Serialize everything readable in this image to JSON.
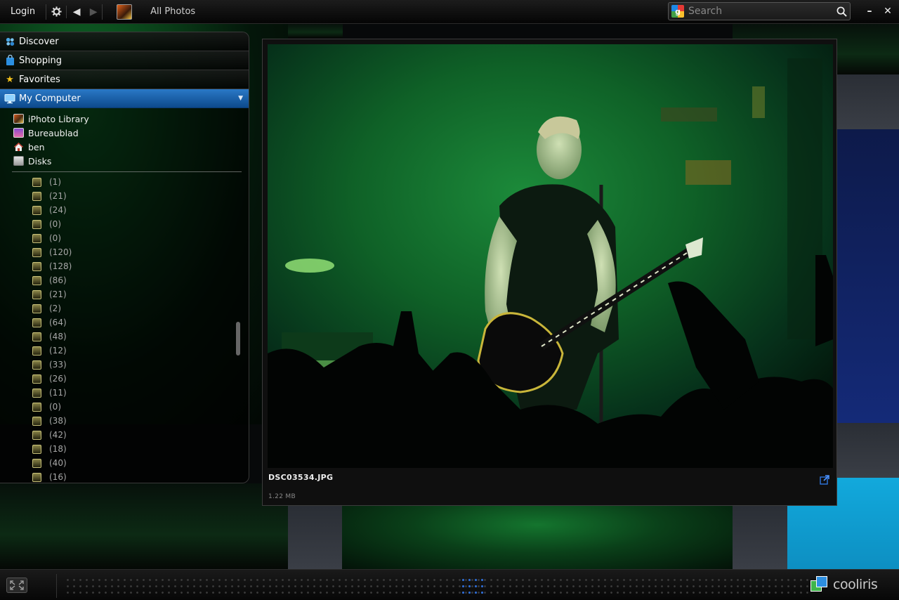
{
  "topbar": {
    "login": "Login",
    "settings_icon": "gear-icon",
    "back_icon": "back-arrow-icon",
    "forward_icon": "forward-arrow-icon",
    "album_icon": "iphoto-album-icon",
    "title": "All Photos",
    "search_placeholder": "Search",
    "search_provider_icon": "google-icon",
    "minimize_icon": "minimize-icon",
    "close_icon": "close-icon"
  },
  "sidebar": {
    "categories": [
      {
        "label": "Discover",
        "icon": "discover-icon"
      },
      {
        "label": "Shopping",
        "icon": "shopping-bag-icon"
      },
      {
        "label": "Favorites",
        "icon": "star-icon"
      },
      {
        "label": "My Computer",
        "icon": "monitor-icon",
        "active": true
      }
    ],
    "tree": [
      {
        "label": "iPhoto Library",
        "icon": "iphoto-icon"
      },
      {
        "label": "Bureaublad",
        "icon": "desktop-icon"
      },
      {
        "label": "ben",
        "icon": "home-icon"
      },
      {
        "label": "Disks",
        "icon": "disk-icon"
      }
    ],
    "albums": [
      "(1)",
      "(21)",
      "(24)",
      "(0)",
      "(0)",
      "(120)",
      "(128)",
      "(86)",
      "(21)",
      "(2)",
      "(64)",
      "(48)",
      "(12)",
      "(33)",
      "(26)",
      "(11)",
      "(0)",
      "(38)",
      "(42)",
      "(18)",
      "(40)",
      "(16)"
    ]
  },
  "viewer": {
    "filename": "DSC03534.JPG",
    "filesize": "1.22 MB",
    "open_external_icon": "external-link-icon"
  },
  "bottombar": {
    "fullscreen_icon": "fullscreen-icon",
    "brand": "cooliris",
    "brand_icon": "cooliris-logo-icon"
  },
  "colors": {
    "accent": "#1e6bb8",
    "stage_green": "#0c6a28",
    "cyan_tile": "#12a9dc"
  }
}
